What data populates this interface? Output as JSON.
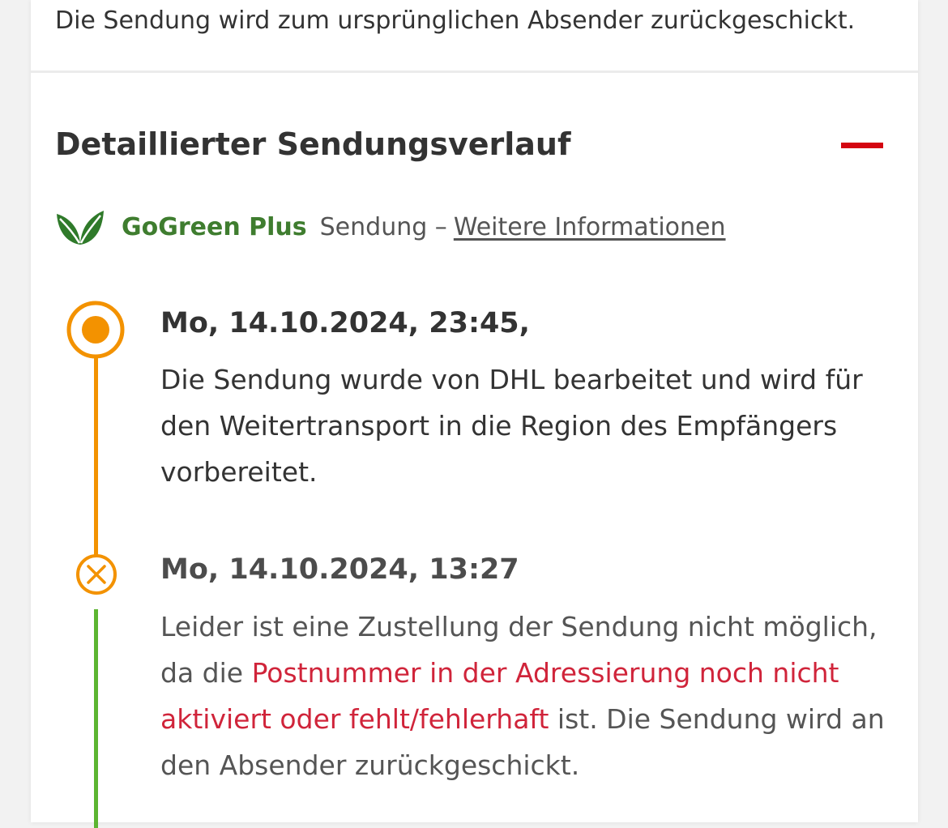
{
  "top_text": "Die Sendung wird zum ursprünglichen Absender zurückgeschickt.",
  "section": {
    "title": "Detaillierter Sendungsverlauf",
    "collapse_icon": "minus-icon"
  },
  "gogreen": {
    "icon": "leaf-icon",
    "label": "GoGreen Plus",
    "text": "Sendung –",
    "link": "Weitere Informationen"
  },
  "events": [
    {
      "date": "Mo, 14.10.2024, 23:45,",
      "text": "Die Sendung wurde von DHL bearbeitet und wird für den Weitertransport in die Region des Empfängers vorbereitet.",
      "icon": "current-status-icon"
    },
    {
      "date": "Mo, 14.10.2024, 13:27",
      "text_before": "Leider ist eine Zustellung der Sendung nicht möglich, da die ",
      "text_highlight": "Postnummer in der Adressierung noch nicht aktiviert oder fehlt/fehlerhaft",
      "text_after": " ist. Die Sendung wird an den Absender zurückgeschickt.",
      "icon": "failed-status-icon"
    }
  ],
  "colors": {
    "accent_red": "#d40511",
    "timeline_orange": "#f39200",
    "timeline_green": "#5cb531",
    "gogreen_green": "#3f7d2f",
    "highlight_red": "#d0243a"
  }
}
